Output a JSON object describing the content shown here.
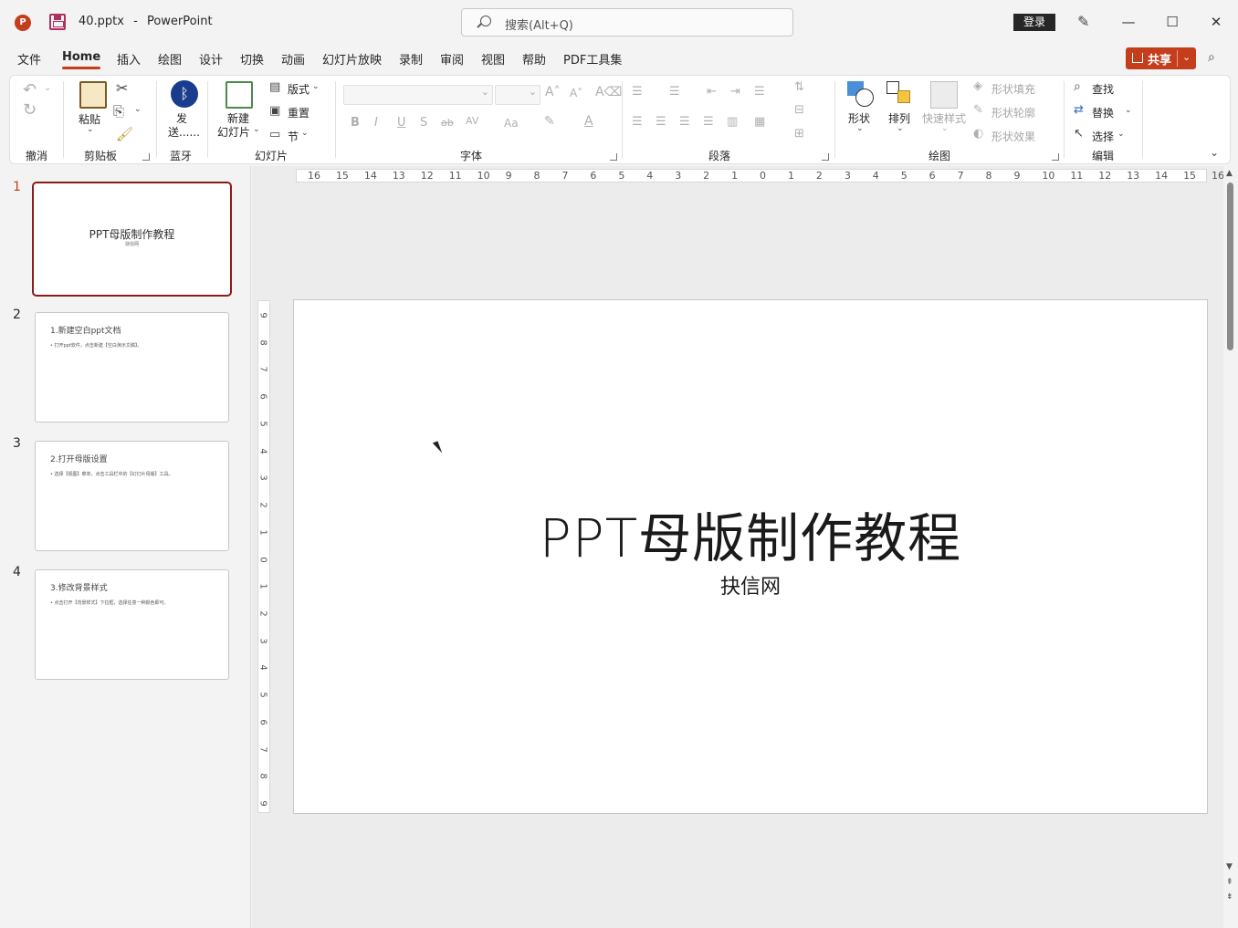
{
  "titlebar": {
    "app_logo": "P",
    "file_name": "40.pptx",
    "separator": "-",
    "app_name": "PowerPoint",
    "search_placeholder": "搜索(Alt+Q)",
    "login_label": "登录"
  },
  "menu": {
    "tabs": [
      "文件",
      "Home",
      "插入",
      "绘图",
      "设计",
      "切换",
      "动画",
      "幻灯片放映",
      "录制",
      "审阅",
      "视图",
      "帮助",
      "PDF工具集"
    ],
    "active_tab": "Home",
    "share_label": "共享"
  },
  "ribbon": {
    "groups": {
      "undo": "撤消",
      "clipboard": "剪贴板",
      "bluetooth": "蓝牙",
      "slides": "幻灯片",
      "font": "字体",
      "paragraph": "段落",
      "drawing": "绘图",
      "editing": "编辑"
    },
    "paste_label": "粘贴",
    "send_label_1": "发",
    "send_label_2": "送......",
    "new_slide_1": "新建",
    "new_slide_2": "幻灯片",
    "layout_label": "版式",
    "reset_label": "重置",
    "section_label": "节",
    "shapes_label": "形状",
    "arrange_label": "排列",
    "quick_styles_label": "快速样式",
    "shape_fill_label": "形状填充",
    "shape_outline_label": "形状轮廓",
    "shape_effects_label": "形状效果",
    "find_label": "查找",
    "replace_label": "替换",
    "select_label": "选择",
    "font_buttons": [
      "B",
      "I",
      "U",
      "S",
      "ab",
      "AV",
      "Aa"
    ]
  },
  "slides": [
    {
      "number": "1",
      "title": "PPT母版制作教程",
      "subtitle": "抉信网"
    },
    {
      "number": "2",
      "heading": "1.新建空白ppt文档",
      "bullet": "• 打开ppt软件，点击新建【空白演示文稿】。"
    },
    {
      "number": "3",
      "heading": "2.打开母版设置",
      "bullet": "• 选择【视图】菜单，点击工具栏中的【幻灯片母版】工具。"
    },
    {
      "number": "4",
      "heading": "3.修改背景样式",
      "bullet": "• 点击打开【背景样式】下拉框，选择任意一种颜色即可。"
    }
  ],
  "current_slide": {
    "title": "PPT母版制作教程",
    "subtitle": "抉信网"
  },
  "rulers": {
    "horizontal": [
      "16",
      "15",
      "14",
      "13",
      "12",
      "11",
      "10",
      "9",
      "8",
      "7",
      "6",
      "5",
      "4",
      "3",
      "2",
      "1",
      "0",
      "1",
      "2",
      "3",
      "4",
      "5",
      "6",
      "7",
      "8",
      "9",
      "10",
      "11",
      "12",
      "13",
      "14",
      "15",
      "16"
    ],
    "vertical": [
      "9",
      "8",
      "7",
      "6",
      "5",
      "4",
      "3",
      "2",
      "1",
      "0",
      "1",
      "2",
      "3",
      "4",
      "5",
      "6",
      "7",
      "8",
      "9"
    ]
  },
  "colors": {
    "accent": "#c43e1c",
    "selected_thumb_border": "#8b1a1a"
  }
}
